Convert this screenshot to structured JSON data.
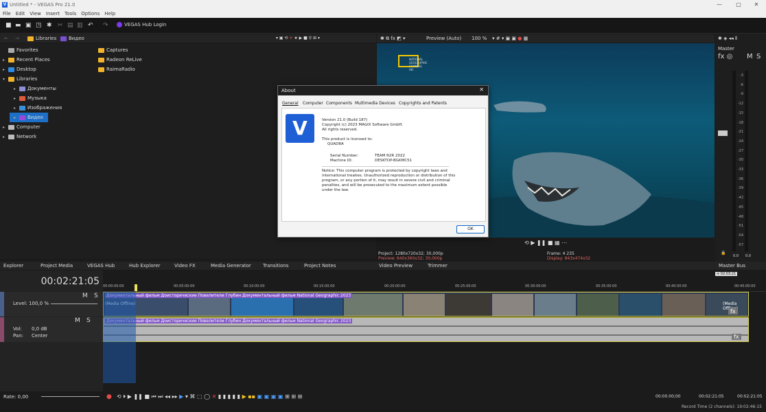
{
  "window": {
    "title": "Untitled * - VEGAS Pro 21.0",
    "minimize": "—",
    "maximize": "▢",
    "close": "✕"
  },
  "menu": [
    "File",
    "Edit",
    "View",
    "Insert",
    "Tools",
    "Options",
    "Help"
  ],
  "toolbar": {
    "hub_login": "VEGAS Hub Login"
  },
  "explorer": {
    "crumbs": [
      "Libraries",
      "Видео"
    ],
    "tree": [
      {
        "label": "Favorites",
        "color": "#aaaaaa"
      },
      {
        "label": "Recent Places",
        "color": "#f2b42c"
      },
      {
        "label": "Desktop",
        "color": "#2e8be6"
      },
      {
        "label": "Libraries",
        "color": "#f2b42c"
      },
      {
        "label": "Документы",
        "color": "#8a8fd6"
      },
      {
        "label": "Музыка",
        "color": "#e05a3c"
      },
      {
        "label": "Изображения",
        "color": "#3c8fd6"
      },
      {
        "label": "Видео",
        "color": "#9a4ad6"
      },
      {
        "label": "Computer",
        "color": "#bbbbbb"
      },
      {
        "label": "Network",
        "color": "#bbbbbb"
      }
    ],
    "files": [
      "Captures",
      "Radeon ReLive",
      "RaimaRadio"
    ]
  },
  "preview": {
    "quality": "Preview (Auto)",
    "zoom": "100 %",
    "logo_text": "NATIONAL GEOGRAPHIC CHANNEL HD",
    "project": "Project:  1280x720x32; 30,000p",
    "preview": "Preview:  640x360x32; 30,000p",
    "frame": "Frame:   4 235",
    "display": "Display:  843x474x32"
  },
  "master": {
    "label": "Master",
    "m": "M",
    "s": "S",
    "scale": [
      "-3",
      "-6",
      "-9",
      "-12",
      "-15",
      "-18",
      "-21",
      "-24",
      "-27",
      "-30",
      "-33",
      "-36",
      "-39",
      "-42",
      "-45",
      "-48",
      "-51",
      "-54",
      "-57"
    ],
    "left_val": "0.0",
    "right_val": "0.0",
    "bus": "Master Bus"
  },
  "tabs": [
    "Explorer",
    "Project Media",
    "VEGAS Hub",
    "Hub Explorer",
    "Video FX",
    "Media Generator",
    "Transitions",
    "Project Notes",
    "Video Preview",
    "Trimmer"
  ],
  "timeline": {
    "timecode": "00:02:21:05",
    "level": "Level: 100,0 %",
    "vol": "Vol:",
    "vol_val": "0,0 dB",
    "pan": "Pan:",
    "pan_val": "Center",
    "ruler": [
      "00:00:00:00",
      "00:05:00:00",
      "00:10:00:00",
      "00:15:00:00",
      "00:20:00:00",
      "00:25:00:00",
      "00:30:00:00",
      "00:35:00:00",
      "00:40:00:00",
      "00:45:00:00"
    ],
    "clip_name": "Документальный фильм Доисторические Повелители Глубин  Документальный фильм National Geographic 2023",
    "media_offline": "(Media Offline)",
    "fx": "fx",
    "ruler_marker": "+ 02:03:21"
  },
  "transport": {
    "rate": "Rate: 0,00",
    "t1": "00:00:00;00",
    "t2": "00:02:21:05",
    "t3": "00:02:21:05"
  },
  "status": {
    "record": "Record Time (2 channels): 19:02:46:15"
  },
  "about": {
    "title": "About",
    "tabs": [
      "General",
      "Computer",
      "Components",
      "Multimedia Devices",
      "Copyrights and Patents"
    ],
    "logo": "V",
    "version": "Version 21.0 (Build 187)",
    "copyright": "Copyright (c) 2023 MAGIX Software GmbH.",
    "rights": "All rights reserved.",
    "licensed": "This product is licensed to:",
    "licensee": "QUADRA",
    "serial_label": "Serial Number:",
    "serial_value": "TEAM R2R 2022",
    "machine_label": "Machine ID:",
    "machine_value": "DESKTOP-BGKMC51",
    "notice": [
      "Notice: This computer program is protected by copyright laws and",
      "international treaties. Unauthorized reproduction or distribution of this",
      "program, or any portion of it, may result in severe civil and criminal",
      "penalties, and will be prosecuted to the maximum extent possible",
      "under the law."
    ],
    "ok": "OK"
  }
}
